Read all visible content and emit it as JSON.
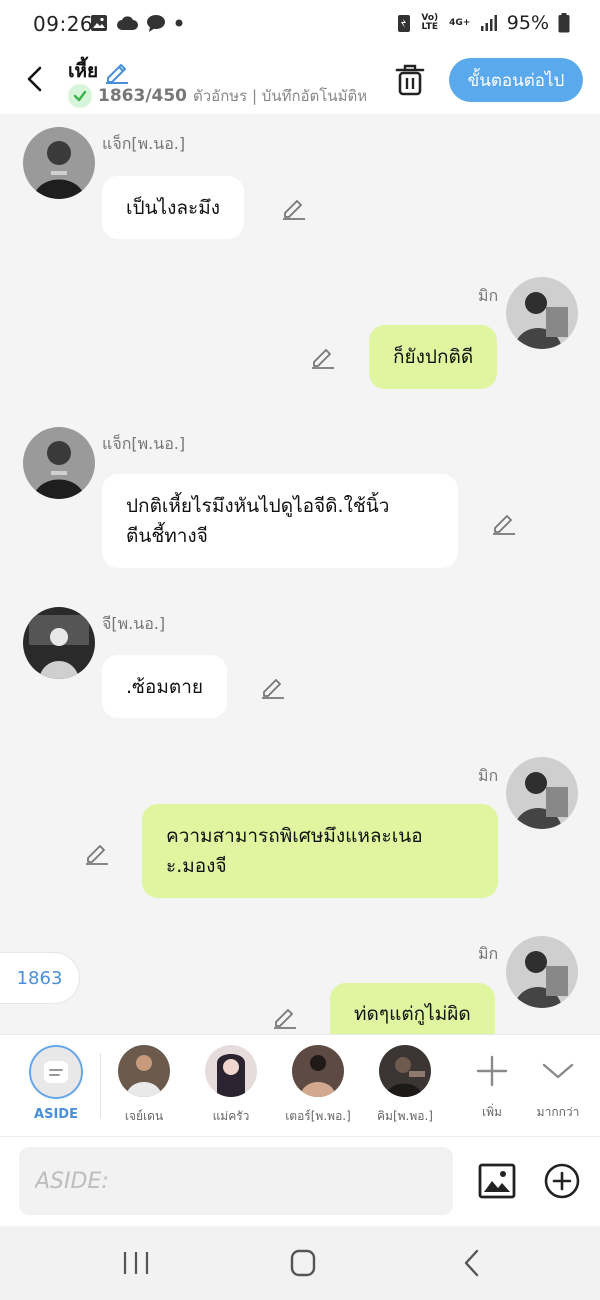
{
  "status_bar": {
    "time": "09:26",
    "volte": "Vo) LTE",
    "network": "4G+",
    "battery": "95%",
    "icons": [
      "gallery-icon",
      "cloud-icon",
      "chat-bubble-icon",
      "dot-icon",
      "battery-saver-icon",
      "signal-icon",
      "battery-icon"
    ]
  },
  "header": {
    "title": "เหี้ย",
    "char_count": "1863/450",
    "char_desc": "ตัวอักษร | บันทึกอัตโนมัติหล",
    "next_label": "ขั้นตอนต่อไป",
    "accent": "#5aa9ec"
  },
  "messages": [
    {
      "side": "in",
      "sender": "แจ็ก[พ.นอ.]",
      "lines": [
        "เป็นไงละมึง"
      ]
    },
    {
      "side": "out",
      "sender": "มิก",
      "lines": [
        "ก็ยังปกติดี"
      ]
    },
    {
      "side": "in",
      "sender": "แจ็ก[พ.นอ.]",
      "lines": [
        "ปกติเหี้ยไรมึงหันไปดูไอจีดิ.ใช้นิ้ว",
        "ตีนชี้ทางจี"
      ]
    },
    {
      "side": "in",
      "sender": "จี[พ.นอ.]",
      "lines": [
        ".ซ้อมตาย"
      ]
    },
    {
      "side": "out",
      "sender": "มิก",
      "lines": [
        "ความสามารถพิเศษมึงแหละเนอ",
        "ะ.มองจี"
      ]
    },
    {
      "side": "out",
      "sender": "มิก",
      "lines": [
        "ท่ดๆแต่กูไม่ผิด"
      ]
    }
  ],
  "count_pill": "1863",
  "strip": {
    "aside_label": "ASIDE",
    "characters": [
      {
        "label": "เจย์เดน"
      },
      {
        "label": "แม่ครัว"
      },
      {
        "label": "เตอร์[พ.พอ.]"
      },
      {
        "label": "คิม[พ.พอ.]"
      }
    ],
    "more_label": "เพิ่ม",
    "expand_label": "มากกว่า"
  },
  "input": {
    "placeholder": "ASIDE:"
  },
  "colors": {
    "out_bubble": "#dff5a0",
    "in_bubble": "#ffffff",
    "link": "#4a90d9"
  }
}
